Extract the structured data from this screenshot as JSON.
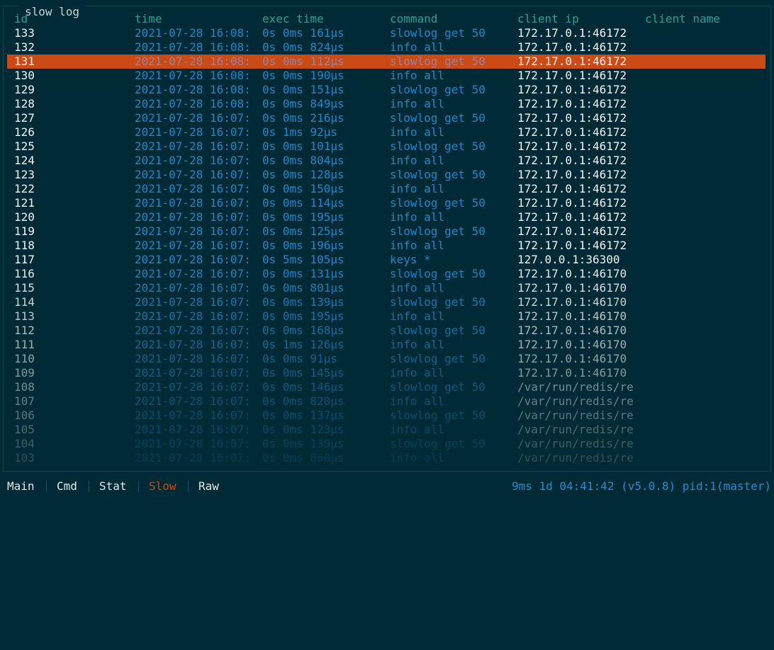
{
  "panel": {
    "title": "slow log"
  },
  "columns": {
    "id": "id",
    "time": "time",
    "exec": "exec time",
    "command": "command",
    "client_ip": "client ip",
    "client_name": "client name"
  },
  "colors": {
    "background": "#002b36",
    "header": "#2aa198",
    "id_text": "#f4f4f4",
    "time_text": "#268bd2",
    "command_text": "#268bd2",
    "ip_text": "#f4f4f4",
    "selected_row": "#cb4b16",
    "active_tab": "#cb4b16",
    "status_text": "#268bd2"
  },
  "selected_id": "131",
  "rows": [
    {
      "id": "133",
      "time": "2021-07-28 16:08:",
      "exec": "0s 0ms 161μs",
      "command": "slowlog get 50",
      "client_ip": "172.17.0.1:46172",
      "client_name": ""
    },
    {
      "id": "132",
      "time": "2021-07-28 16:08:",
      "exec": "0s 0ms 824μs",
      "command": "info all",
      "client_ip": "172.17.0.1:46172",
      "client_name": ""
    },
    {
      "id": "131",
      "time": "2021-07-28 16:08:",
      "exec": "0s 0ms 112μs",
      "command": "slowlog get 50",
      "client_ip": "172.17.0.1:46172",
      "client_name": ""
    },
    {
      "id": "130",
      "time": "2021-07-28 16:08:",
      "exec": "0s 0ms 190μs",
      "command": "info all",
      "client_ip": "172.17.0.1:46172",
      "client_name": ""
    },
    {
      "id": "129",
      "time": "2021-07-28 16:08:",
      "exec": "0s 0ms 151μs",
      "command": "slowlog get 50",
      "client_ip": "172.17.0.1:46172",
      "client_name": ""
    },
    {
      "id": "128",
      "time": "2021-07-28 16:08:",
      "exec": "0s 0ms 849μs",
      "command": "info all",
      "client_ip": "172.17.0.1:46172",
      "client_name": ""
    },
    {
      "id": "127",
      "time": "2021-07-28 16:07:",
      "exec": "0s 0ms 216μs",
      "command": "slowlog get 50",
      "client_ip": "172.17.0.1:46172",
      "client_name": ""
    },
    {
      "id": "126",
      "time": "2021-07-28 16:07:",
      "exec": "0s 1ms 92μs",
      "command": "info all",
      "client_ip": "172.17.0.1:46172",
      "client_name": ""
    },
    {
      "id": "125",
      "time": "2021-07-28 16:07:",
      "exec": "0s 0ms 101μs",
      "command": "slowlog get 50",
      "client_ip": "172.17.0.1:46172",
      "client_name": ""
    },
    {
      "id": "124",
      "time": "2021-07-28 16:07:",
      "exec": "0s 0ms 804μs",
      "command": "info all",
      "client_ip": "172.17.0.1:46172",
      "client_name": ""
    },
    {
      "id": "123",
      "time": "2021-07-28 16:07:",
      "exec": "0s 0ms 128μs",
      "command": "slowlog get 50",
      "client_ip": "172.17.0.1:46172",
      "client_name": ""
    },
    {
      "id": "122",
      "time": "2021-07-28 16:07:",
      "exec": "0s 0ms 150μs",
      "command": "info all",
      "client_ip": "172.17.0.1:46172",
      "client_name": ""
    },
    {
      "id": "121",
      "time": "2021-07-28 16:07:",
      "exec": "0s 0ms 114μs",
      "command": "slowlog get 50",
      "client_ip": "172.17.0.1:46172",
      "client_name": ""
    },
    {
      "id": "120",
      "time": "2021-07-28 16:07:",
      "exec": "0s 0ms 195μs",
      "command": "info all",
      "client_ip": "172.17.0.1:46172",
      "client_name": ""
    },
    {
      "id": "119",
      "time": "2021-07-28 16:07:",
      "exec": "0s 0ms 125μs",
      "command": "slowlog get 50",
      "client_ip": "172.17.0.1:46172",
      "client_name": ""
    },
    {
      "id": "118",
      "time": "2021-07-28 16:07:",
      "exec": "0s 0ms 196μs",
      "command": "info all",
      "client_ip": "172.17.0.1:46172",
      "client_name": ""
    },
    {
      "id": "117",
      "time": "2021-07-28 16:07:",
      "exec": "0s 5ms 105μs",
      "command": "keys *",
      "client_ip": "127.0.0.1:36300",
      "client_name": ""
    },
    {
      "id": "116",
      "time": "2021-07-28 16:07:",
      "exec": "0s 0ms 131μs",
      "command": "slowlog get 50",
      "client_ip": "172.17.0.1:46170",
      "client_name": ""
    },
    {
      "id": "115",
      "time": "2021-07-28 16:07:",
      "exec": "0s 0ms 801μs",
      "command": "info all",
      "client_ip": "172.17.0.1:46170",
      "client_name": ""
    },
    {
      "id": "114",
      "time": "2021-07-28 16:07:",
      "exec": "0s 0ms 139μs",
      "command": "slowlog get 50",
      "client_ip": "172.17.0.1:46170",
      "client_name": ""
    },
    {
      "id": "113",
      "time": "2021-07-28 16:07:",
      "exec": "0s 0ms 195μs",
      "command": "info all",
      "client_ip": "172.17.0.1:46170",
      "client_name": ""
    },
    {
      "id": "112",
      "time": "2021-07-28 16:07:",
      "exec": "0s 0ms 168μs",
      "command": "slowlog get 50",
      "client_ip": "172.17.0.1:46170",
      "client_name": ""
    },
    {
      "id": "111",
      "time": "2021-07-28 16:07:",
      "exec": "0s 1ms 126μs",
      "command": "info all",
      "client_ip": "172.17.0.1:46170",
      "client_name": ""
    },
    {
      "id": "110",
      "time": "2021-07-28 16:07:",
      "exec": "0s 0ms 91μs",
      "command": "slowlog get 50",
      "client_ip": "172.17.0.1:46170",
      "client_name": ""
    },
    {
      "id": "109",
      "time": "2021-07-28 16:07:",
      "exec": "0s 0ms 145μs",
      "command": "info all",
      "client_ip": "172.17.0.1:46170",
      "client_name": ""
    },
    {
      "id": "108",
      "time": "2021-07-28 16:07:",
      "exec": "0s 0ms 146μs",
      "command": "slowlog get 50",
      "client_ip": "/var/run/redis/re",
      "client_name": ""
    },
    {
      "id": "107",
      "time": "2021-07-28 16:07:",
      "exec": "0s 0ms 820μs",
      "command": "info all",
      "client_ip": "/var/run/redis/re",
      "client_name": ""
    },
    {
      "id": "106",
      "time": "2021-07-28 16:07:",
      "exec": "0s 0ms 137μs",
      "command": "slowlog get 50",
      "client_ip": "/var/run/redis/re",
      "client_name": ""
    },
    {
      "id": "105",
      "time": "2021-07-28 16:07:",
      "exec": "0s 0ms 123μs",
      "command": "info all",
      "client_ip": "/var/run/redis/re",
      "client_name": ""
    },
    {
      "id": "104",
      "time": "2021-07-28 16:07:",
      "exec": "0s 0ms 139μs",
      "command": "slowlog get 50",
      "client_ip": "/var/run/redis/re",
      "client_name": ""
    },
    {
      "id": "103",
      "time": "2021-07-28 16:07:",
      "exec": "0s 0ms 860μs",
      "command": "info all",
      "client_ip": "/var/run/redis/re",
      "client_name": ""
    }
  ],
  "tabs": [
    {
      "label": "Main",
      "active": false
    },
    {
      "label": "Cmd",
      "active": false
    },
    {
      "label": "Stat",
      "active": false
    },
    {
      "label": "Slow",
      "active": true
    },
    {
      "label": "Raw",
      "active": false
    }
  ],
  "status": {
    "text": "9ms 1d 04:41:42 (v5.0.8) pid:1(master)"
  }
}
